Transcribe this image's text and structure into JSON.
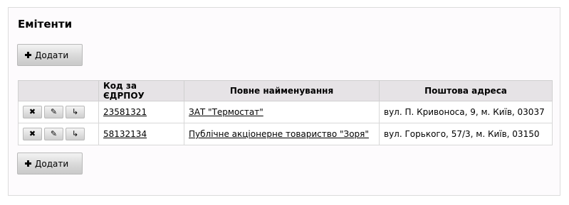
{
  "page": {
    "title": "Емітенти",
    "add_button_label": "Додати"
  },
  "table": {
    "headers": {
      "actions": "",
      "code": "Код за ЄДРПОУ",
      "name": "Повне найменування",
      "address": "Поштова адреса"
    },
    "action_icons": {
      "delete": "✖",
      "edit": "✎",
      "open": "↳"
    },
    "rows": [
      {
        "code": "23581321",
        "name": "ЗАТ \"Термостат\"",
        "address": "вул. П. Кривоноса, 9, м. Київ, 03037"
      },
      {
        "code": "58132134",
        "name": "Публічне акціонерне товариство \"Зоря\"",
        "address": "вул. Горького, 57/3, м. Київ, 03150"
      }
    ]
  }
}
